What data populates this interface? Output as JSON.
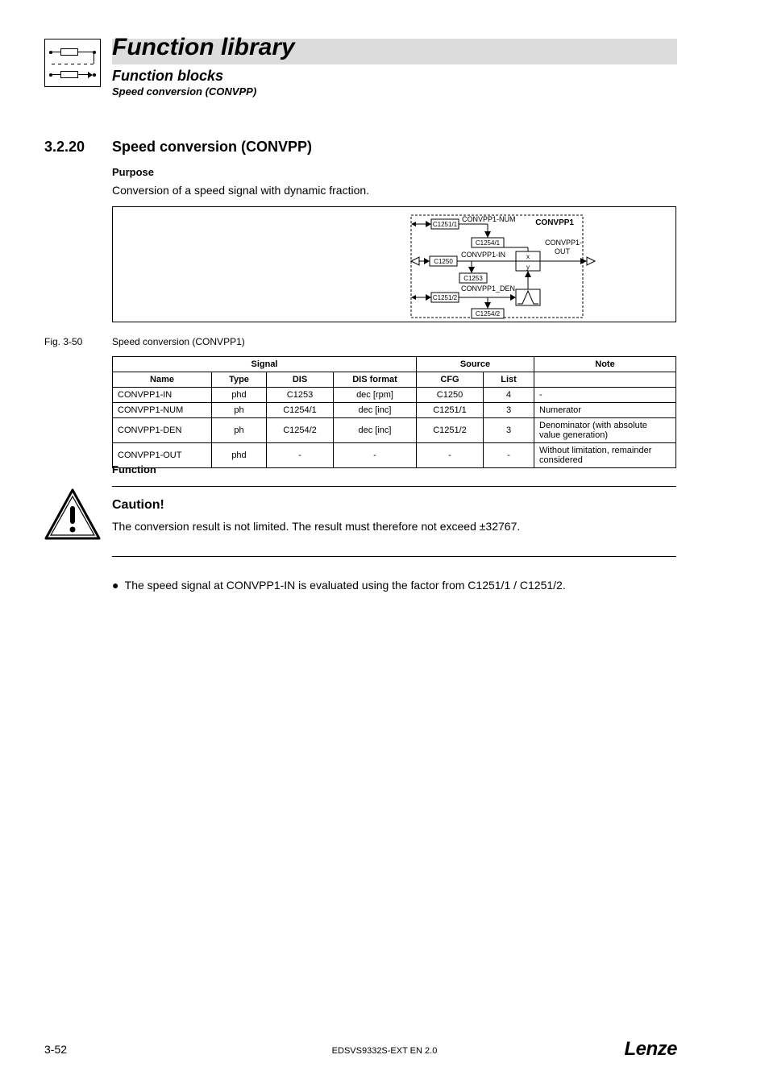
{
  "header": {
    "title": "Function library",
    "subtitle1": "Function blocks",
    "subtitle2": "Speed conversion (CONVPP)"
  },
  "section": {
    "number": "3.2.20",
    "title": "Speed conversion (CONVPP)",
    "purpose_heading": "Purpose",
    "purpose_text": "Conversion of a speed signal with dynamic fraction."
  },
  "diagram": {
    "block_title": "CONVPP1",
    "num_label": "CONVPP1-NUM",
    "num_code_in": "C1251/1",
    "num_disp": "C1254/1",
    "in_label": "CONVPP1-IN",
    "in_code": "C1250",
    "in_disp": "C1253",
    "x": "x",
    "y": "y",
    "out_label_1": "CONVPP1-",
    "out_label_2": "OUT",
    "den_label": "CONVPP1_DEN",
    "den_code_in": "C1251/2",
    "den_disp": "C1254/2"
  },
  "figure": {
    "label": "Fig. 3-50",
    "text": "Speed conversion (CONVPP1)"
  },
  "table": {
    "head_signal": "Signal",
    "head_source": "Source",
    "head_note": "Note",
    "sub_name": "Name",
    "sub_type": "Type",
    "sub_dis": "DIS",
    "sub_fmt": "DIS format",
    "sub_cfg": "CFG",
    "sub_list": "List",
    "rows": [
      {
        "name": "CONVPP1-IN",
        "type": "phd",
        "dis": "C1253",
        "fmt": "dec [rpm]",
        "cfg": "C1250",
        "list": "4",
        "note": "-"
      },
      {
        "name": "CONVPP1-NUM",
        "type": "ph",
        "dis": "C1254/1",
        "fmt": "dec [inc]",
        "cfg": "C1251/1",
        "list": "3",
        "note": "Numerator"
      },
      {
        "name": "CONVPP1-DEN",
        "type": "ph",
        "dis": "C1254/2",
        "fmt": "dec [inc]",
        "cfg": "C1251/2",
        "list": "3",
        "note": "Denominator (with absolute value generation)"
      },
      {
        "name": "CONVPP1-OUT",
        "type": "phd",
        "dis": "-",
        "fmt": "-",
        "cfg": "-",
        "list": "-",
        "note": "Without limitation, remainder considered"
      }
    ]
  },
  "function_heading": "Function",
  "caution": {
    "heading": "Caution!",
    "text": "The conversion result is not limited. The result must therefore not exceed ±32767."
  },
  "bullet": "The speed signal at CONVPP1-IN is evaluated using the factor from C1251/1 / C1251/2.",
  "footer": {
    "page": "3-52",
    "docid": "EDSVS9332S-EXT EN 2.0",
    "brand": "Lenze"
  }
}
